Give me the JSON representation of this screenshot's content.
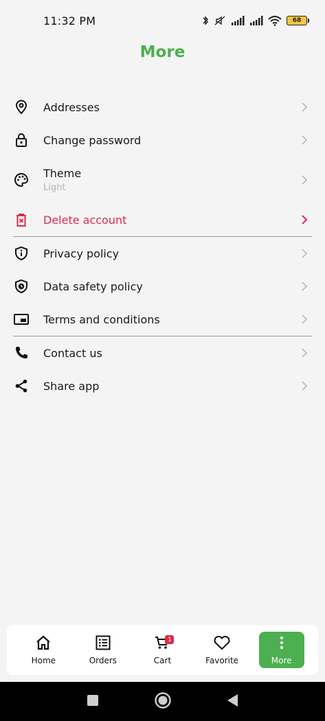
{
  "status_bar": {
    "time": "11:32 PM",
    "battery": "68",
    "icons": [
      "bluetooth-icon",
      "mute-icon",
      "signal-icon",
      "signal-icon",
      "wifi-icon",
      "battery-icon"
    ]
  },
  "page": {
    "title": "More"
  },
  "menu": {
    "items": [
      {
        "label": "Addresses",
        "icon": "location-pin-icon"
      },
      {
        "label": "Change password",
        "icon": "lock-icon"
      },
      {
        "label": "Theme",
        "sub": "Light",
        "icon": "palette-icon"
      },
      {
        "label": "Delete account",
        "icon": "trash-icon"
      },
      {
        "label": "Privacy policy",
        "icon": "shield-info-icon"
      },
      {
        "label": "Data safety policy",
        "icon": "shield-clock-icon"
      },
      {
        "label": "Terms and conditions",
        "icon": "picture-in-picture-icon"
      },
      {
        "label": "Contact us",
        "icon": "phone-icon"
      },
      {
        "label": "Share app",
        "icon": "share-icon"
      }
    ]
  },
  "bottom_nav": {
    "items": [
      {
        "label": "Home",
        "icon": "home-icon"
      },
      {
        "label": "Orders",
        "icon": "orders-list-icon"
      },
      {
        "label": "Cart",
        "icon": "cart-icon",
        "badge": "1"
      },
      {
        "label": "Favorite",
        "icon": "heart-icon"
      },
      {
        "label": "More",
        "icon": "more-vertical-icon",
        "active": true
      }
    ]
  },
  "colors": {
    "accent": "#4caf50",
    "danger": "#e0294a",
    "background": "#f4f4f4"
  }
}
